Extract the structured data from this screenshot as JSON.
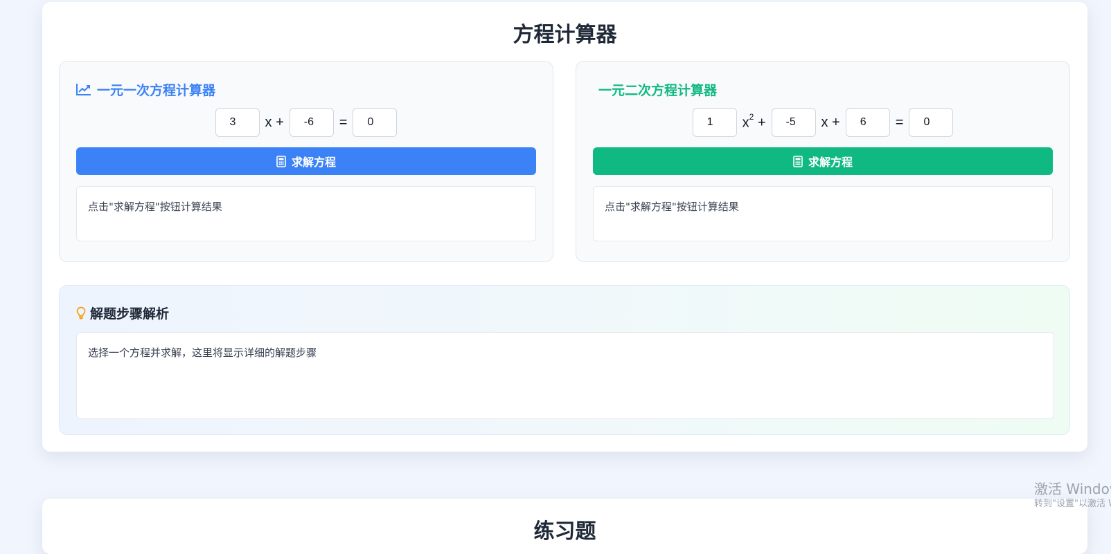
{
  "main": {
    "title": "方程计算器"
  },
  "linear": {
    "heading": "一元一次方程计算器",
    "icon": "chart-line-icon",
    "accent": "#3b82f6",
    "a_value": "3",
    "b_value": "-6",
    "c_value": "0",
    "x_plus": "x +",
    "equals": "=",
    "solve_label": "求解方程",
    "result_text": "点击\"求解方程\"按钮计算结果"
  },
  "quadratic": {
    "heading": "一元二次方程计算器",
    "accent": "#10b981",
    "a_value": "1",
    "b_value": "-5",
    "c_value": "6",
    "d_value": "0",
    "x2_base": "x",
    "x2_exp": "2",
    "plus": "+",
    "x_plus": "x +",
    "equals": "=",
    "solve_label": "求解方程",
    "result_text": "点击\"求解方程\"按钮计算结果"
  },
  "steps": {
    "heading": "解题步骤解析",
    "icon": "lightbulb-icon",
    "placeholder_text": "选择一个方程并求解，这里将显示详细的解题步骤"
  },
  "practice": {
    "title": "练习题"
  },
  "watermark": {
    "line1": "激活 Windows",
    "line2": "转到\"设置\"以激活 Windows。"
  }
}
